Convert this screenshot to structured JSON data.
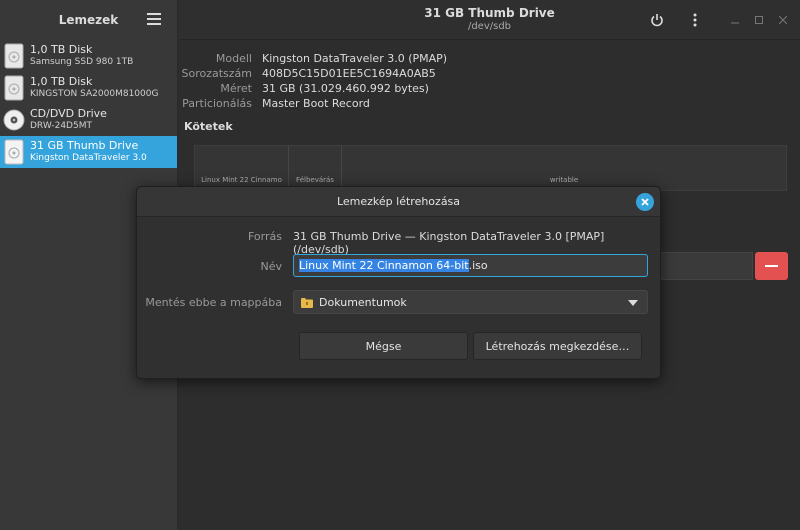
{
  "sidebar": {
    "title": "Lemezek",
    "items": [
      {
        "name": "1,0 TB Disk",
        "sub": "Samsung SSD 980 1TB",
        "icon": "hard-disk-icon"
      },
      {
        "name": "1,0 TB Disk",
        "sub": "KINGSTON SA2000M81000G",
        "icon": "hard-disk-icon"
      },
      {
        "name": "CD/DVD Drive",
        "sub": "DRW-24D5MT",
        "icon": "optical-disc-icon"
      },
      {
        "name": "31 GB Thumb Drive",
        "sub": "Kingston DataTraveler 3.0",
        "icon": "usb-drive-icon",
        "selected": true
      }
    ]
  },
  "window": {
    "title": "31 GB Thumb Drive",
    "subtitle": "/dev/sdb"
  },
  "drive_info": {
    "rows": [
      {
        "label": "Modell",
        "value": "Kingston DataTraveler 3.0 (PMAP)"
      },
      {
        "label": "Sorozatszám",
        "value": "408D5C15D01EE5C1694A0AB5"
      },
      {
        "label": "Méret",
        "value": "31 GB (31.029.460.992 bytes)"
      },
      {
        "label": "Particionálás",
        "value": "Master Boot Record"
      }
    ]
  },
  "volumes": {
    "title": "Kötetek",
    "parts": [
      "Linux Mint 22 Cinnamo",
      "Félbevárás",
      "writable"
    ]
  },
  "dialog": {
    "title": "Lemezkép létrehozása",
    "source_label": "Forrás",
    "source_value": "31 GB Thumb Drive — Kingston DataTraveler 3.0 [PMAP] (/dev/sdb)",
    "name_label": "Név",
    "name_selected": "Linux Mint 22 Cinnamon 64-bit",
    "name_ext": ".iso",
    "folder_label": "Mentés ebbe a mappába",
    "folder_value": "Dokumentumok",
    "cancel_label": "Mégse",
    "start_label": "Létrehozás megkezdése…"
  },
  "colors": {
    "accent": "#35a4dc",
    "danger": "#e35151",
    "text_selection": "#3584e4"
  }
}
